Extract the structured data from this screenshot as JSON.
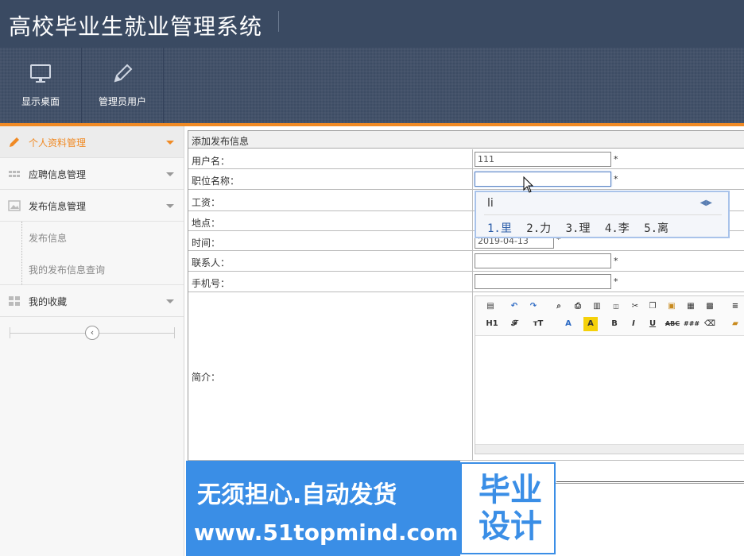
{
  "header": {
    "title": "高校毕业生就业管理系统"
  },
  "toolbar": {
    "items": [
      {
        "label": "显示桌面",
        "icon": "monitor-icon"
      },
      {
        "label": "管理员用户",
        "icon": "pencil-icon"
      }
    ]
  },
  "sidebar": {
    "items": [
      {
        "label": "个人资料管理",
        "icon": "pencil-icon",
        "active": true
      },
      {
        "label": "应聘信息管理",
        "icon": "grid-icon"
      },
      {
        "label": "发布信息管理",
        "icon": "image-icon"
      },
      {
        "label": "我的收藏",
        "icon": "tiles-icon"
      }
    ],
    "subitems": [
      "发布信息",
      "我的发布信息查询"
    ],
    "collapse_glyph": "‹"
  },
  "form": {
    "title": "添加发布信息",
    "fields": [
      {
        "label": "用户名：",
        "value": "111",
        "required": "*"
      },
      {
        "label": "职位名称：",
        "value": "",
        "required": "*"
      },
      {
        "label": "工资：",
        "value": ""
      },
      {
        "label": "地点：",
        "value": ""
      },
      {
        "label": "时间：",
        "value": "2019-04-13",
        "required": "*"
      },
      {
        "label": "联系人：",
        "value": "",
        "required": "*"
      },
      {
        "label": "手机号：",
        "value": "",
        "required": "*"
      },
      {
        "label": "简介："
      }
    ]
  },
  "editor": {
    "row1": [
      "source-icon",
      "undo-icon",
      "redo-icon",
      "preview-icon",
      "print-icon",
      "template-icon",
      "code-icon",
      "cut-icon",
      "copy-icon",
      "paste-icon",
      "paste-text-icon",
      "paste-word-icon",
      "align-left-icon"
    ],
    "row2": [
      "H1",
      "𝓕",
      "тT",
      "A",
      "A",
      "B",
      "I",
      "U",
      "ABC",
      "###",
      "eraser",
      "image"
    ]
  },
  "ime": {
    "typed": "li",
    "candidates": [
      "1.里",
      "2.力",
      "3.理",
      "4.李",
      "5.离"
    ]
  },
  "watermark": {
    "line1": "无须担心.自动发货",
    "line2": "www.51topmind.com",
    "badge": "毕业 设计"
  },
  "colors": {
    "header": "#3a4a62",
    "accent": "#f08a24",
    "watermark": "#3a8ee6"
  }
}
